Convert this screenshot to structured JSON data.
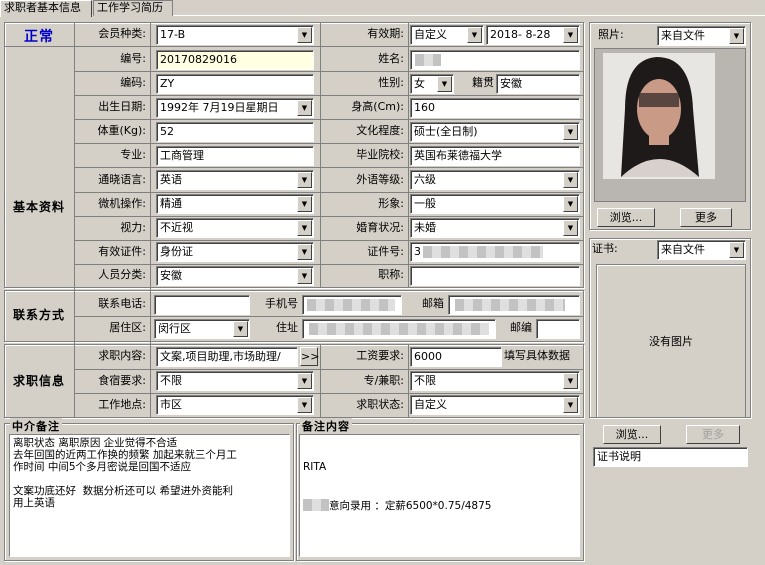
{
  "tabs": [
    {
      "label": "求职者基本信息"
    },
    {
      "label": "工作学习简历"
    }
  ],
  "status": "正常",
  "sections": {
    "basic": "基本资料",
    "contact": "联系方式",
    "job": "求职信息"
  },
  "fields": {
    "member_type": {
      "label": "会员种类:",
      "value": "17-B"
    },
    "valid_period": {
      "label": "有效期:",
      "value": "自定义",
      "date": "2018- 8-28"
    },
    "number": {
      "label": "编号:",
      "value": "20170829016"
    },
    "name": {
      "label": "姓名:",
      "value": ""
    },
    "code": {
      "label": "编码:",
      "value": "ZY"
    },
    "gender": {
      "label": "性别:",
      "value": "女"
    },
    "native": {
      "label": "籍贯",
      "value": "安徽"
    },
    "birthday": {
      "label": "出生日期:",
      "value": "1992年 7月19日星期日"
    },
    "height": {
      "label": "身高(Cm):",
      "value": "160"
    },
    "weight": {
      "label": "体重(Kg):",
      "value": "52"
    },
    "education": {
      "label": "文化程度:",
      "value": "硕士(全日制)"
    },
    "major": {
      "label": "专业:",
      "value": "工商管理"
    },
    "school": {
      "label": "毕业院校:",
      "value": "英国布莱德福大学"
    },
    "language": {
      "label": "通晓语言:",
      "value": "英语"
    },
    "foreign_level": {
      "label": "外语等级:",
      "value": "六级"
    },
    "computer": {
      "label": "微机操作:",
      "value": "精通"
    },
    "appearance": {
      "label": "形象:",
      "value": "一般"
    },
    "vision": {
      "label": "视力:",
      "value": "不近视"
    },
    "marital": {
      "label": "婚育状况:",
      "value": "未婚"
    },
    "id_type": {
      "label": "有效证件:",
      "value": "身份证"
    },
    "id_no": {
      "label": "证件号:",
      "value": "3"
    },
    "category": {
      "label": "人员分类:",
      "value": "安徽"
    },
    "title": {
      "label": "职称:",
      "value": ""
    },
    "phone": {
      "label": "联系电话:",
      "value": ""
    },
    "mobile": {
      "label": "手机号",
      "value": ""
    },
    "email": {
      "label": "邮箱",
      "value": ""
    },
    "district": {
      "label": "居住区:",
      "value": "闵行区"
    },
    "address": {
      "label": "住址",
      "value": ""
    },
    "postcode": {
      "label": "邮编",
      "value": ""
    },
    "job_content": {
      "label": "求职内容:",
      "value": "文案,项目助理,市场助理/"
    },
    "salary": {
      "label": "工资要求:",
      "value": "6000",
      "hint": "填写具体数据"
    },
    "board": {
      "label": "食宿要求:",
      "value": "不限"
    },
    "fulltime": {
      "label": "专/兼职:",
      "value": "不限"
    },
    "location": {
      "label": "工作地点:",
      "value": "市区"
    },
    "job_status": {
      "label": "求职状态:",
      "value": "自定义"
    }
  },
  "expand_btn": ">>",
  "photo": {
    "label": "照片:",
    "source": "来自文件",
    "browse": "浏览...",
    "more": "更多"
  },
  "cert": {
    "label": "证书:",
    "source": "来自文件",
    "empty": "没有图片",
    "browse": "浏览...",
    "more": "更多",
    "desc": "证书说明"
  },
  "agency_note": {
    "title": "中介备注",
    "text": "离职状态 离职原因 企业觉得不合适\n去年回国的近两工作换的频繁 加起来就三个月工\n作时间 中间5个多月密说是回国不适应\n\n文案功底还好  数据分析还可以 希望进外资能利\n用上英语"
  },
  "remark": {
    "title": "备注内容",
    "line1": "RITA",
    "line2": "意向录用 ：定薪6500*0.75/4875"
  },
  "colors": {
    "status": "#0000cc",
    "face": "#d4d0c8",
    "yellow_edit": "#ffffe1"
  }
}
